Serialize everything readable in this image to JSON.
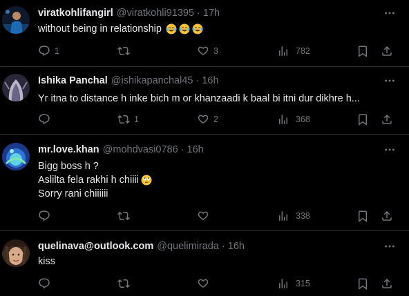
{
  "tweets": [
    {
      "name": "viratkohlifangirl",
      "handle": "@viratkohli91395",
      "time": "17h",
      "lines": [
        "without being in relationship"
      ],
      "emoji": [
        "face-with-tears-of-joy",
        "face-with-tears-of-joy",
        "face-with-tears-of-joy"
      ],
      "replies": "1",
      "reposts": "",
      "likes": "3",
      "views": "782"
    },
    {
      "name": "Ishika Panchal",
      "handle": "@ishikapanchal45",
      "time": "16h",
      "lines": [
        "Yr itna to distance h inke bich m or khanzaadi k baal bi itni dur dikhre h..."
      ],
      "replies": "",
      "reposts": "1",
      "likes": "2",
      "views": "368"
    },
    {
      "name": "mr.love.khan",
      "handle": "@mohdvasi0786",
      "time": "16h",
      "lines": [
        "Bigg boss h ?",
        "Aslilta fela rakhi h chiiii",
        "Sorry rani chiiiiii"
      ],
      "emoji": [
        "face-with-rolling-eyes"
      ],
      "replies": "",
      "reposts": "",
      "likes": "",
      "views": "338"
    },
    {
      "name": "quelinava@outlook.com",
      "handle": "@quelimirada",
      "time": "16h",
      "lines": [
        "kiss"
      ],
      "replies": "",
      "reposts": "",
      "likes": "",
      "views": "315"
    }
  ],
  "dot": "·",
  "colors": {
    "background": "#000000",
    "text": "#e7e9ea",
    "muted": "#71767b",
    "divider": "#2f3336"
  },
  "icons": [
    "more-icon",
    "reply-icon",
    "repost-icon",
    "like-icon",
    "views-icon",
    "bookmark-icon",
    "share-icon"
  ]
}
